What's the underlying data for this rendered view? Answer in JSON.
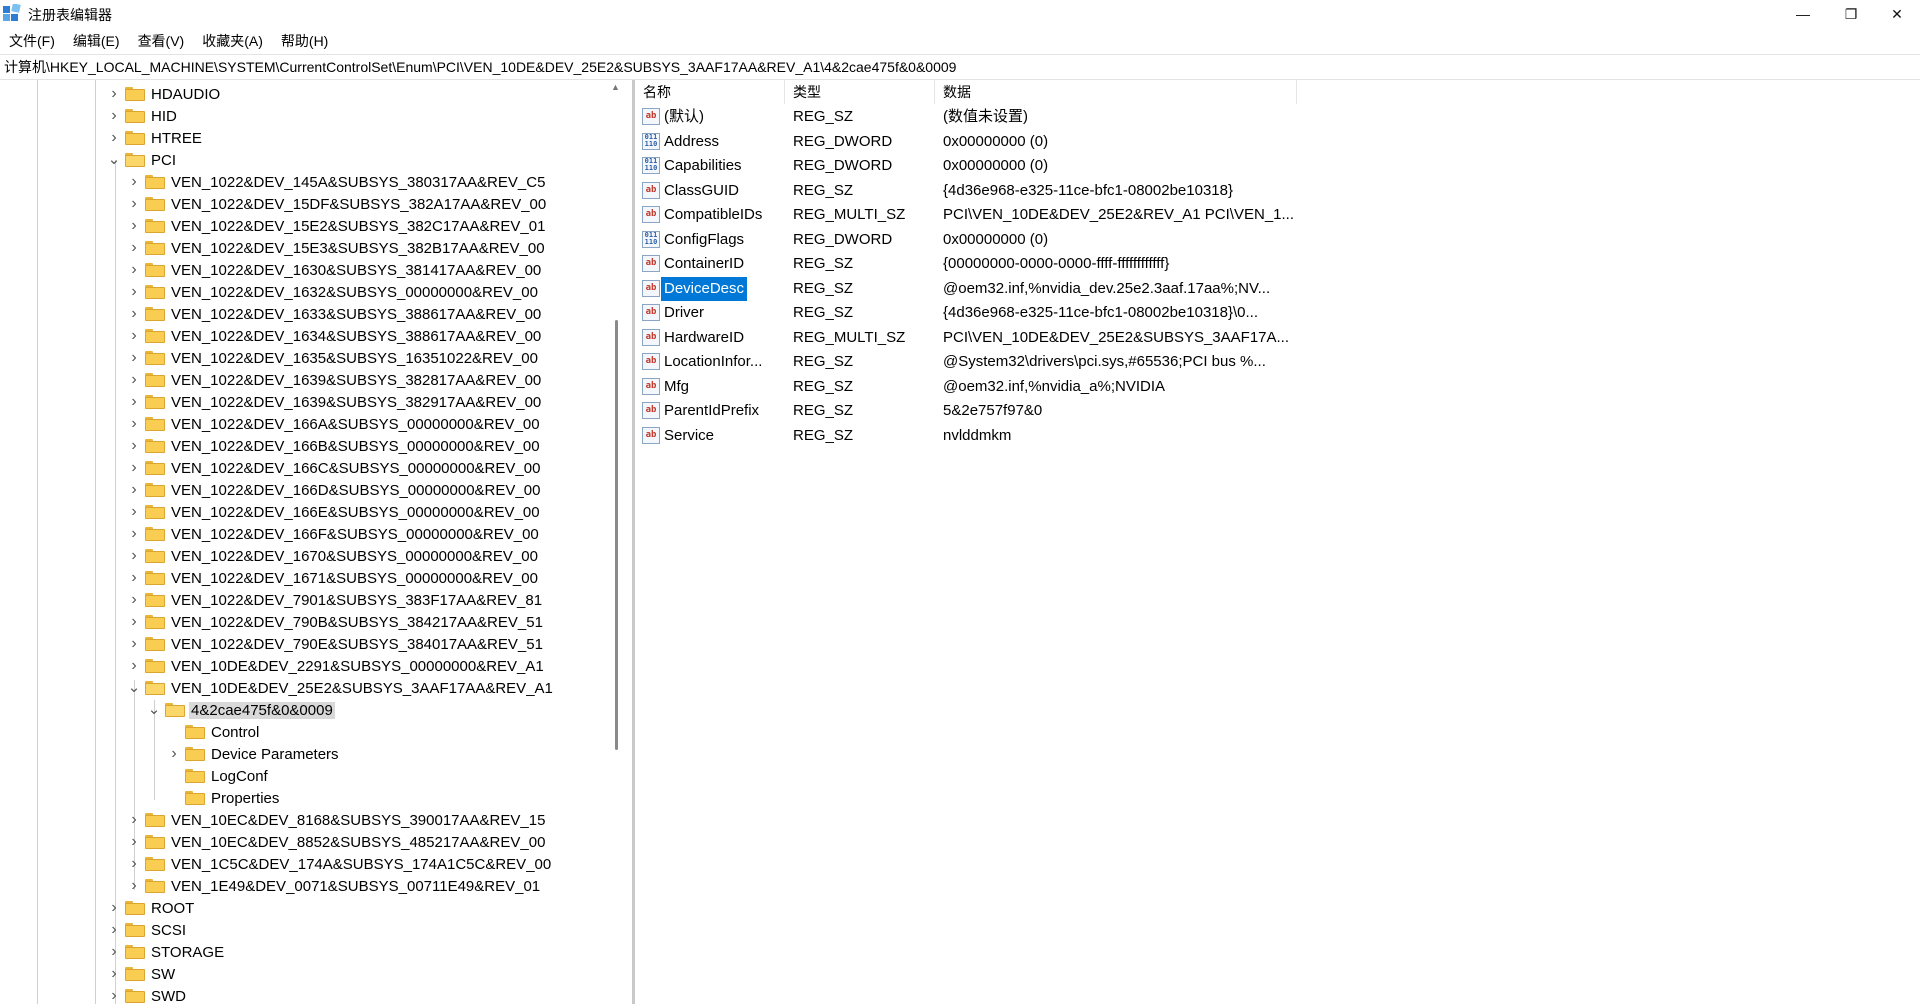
{
  "window": {
    "title": "注册表编辑器",
    "controls": {
      "minimize": "—",
      "maximize": "❐",
      "close": "✕"
    }
  },
  "menu": [
    "文件(F)",
    "编辑(E)",
    "查看(V)",
    "收藏夹(A)",
    "帮助(H)"
  ],
  "address": "计算机\\HKEY_LOCAL_MACHINE\\SYSTEM\\CurrentControlSet\\Enum\\PCI\\VEN_10DE&DEV_25E2&SUBSYS_3AAF17AA&REV_A1\\4&2cae475f&0&0009",
  "tree": [
    {
      "label": "HDAUDIO",
      "level": 0,
      "chev": "right"
    },
    {
      "label": "HID",
      "level": 0,
      "chev": "right"
    },
    {
      "label": "HTREE",
      "level": 0,
      "chev": "right"
    },
    {
      "label": "PCI",
      "level": 0,
      "chev": "down"
    },
    {
      "label": "VEN_1022&DEV_145A&SUBSYS_380317AA&REV_C5",
      "level": 1,
      "chev": "right"
    },
    {
      "label": "VEN_1022&DEV_15DF&SUBSYS_382A17AA&REV_00",
      "level": 1,
      "chev": "right"
    },
    {
      "label": "VEN_1022&DEV_15E2&SUBSYS_382C17AA&REV_01",
      "level": 1,
      "chev": "right"
    },
    {
      "label": "VEN_1022&DEV_15E3&SUBSYS_382B17AA&REV_00",
      "level": 1,
      "chev": "right"
    },
    {
      "label": "VEN_1022&DEV_1630&SUBSYS_381417AA&REV_00",
      "level": 1,
      "chev": "right"
    },
    {
      "label": "VEN_1022&DEV_1632&SUBSYS_00000000&REV_00",
      "level": 1,
      "chev": "right"
    },
    {
      "label": "VEN_1022&DEV_1633&SUBSYS_388617AA&REV_00",
      "level": 1,
      "chev": "right"
    },
    {
      "label": "VEN_1022&DEV_1634&SUBSYS_388617AA&REV_00",
      "level": 1,
      "chev": "right"
    },
    {
      "label": "VEN_1022&DEV_1635&SUBSYS_16351022&REV_00",
      "level": 1,
      "chev": "right"
    },
    {
      "label": "VEN_1022&DEV_1639&SUBSYS_382817AA&REV_00",
      "level": 1,
      "chev": "right"
    },
    {
      "label": "VEN_1022&DEV_1639&SUBSYS_382917AA&REV_00",
      "level": 1,
      "chev": "right"
    },
    {
      "label": "VEN_1022&DEV_166A&SUBSYS_00000000&REV_00",
      "level": 1,
      "chev": "right"
    },
    {
      "label": "VEN_1022&DEV_166B&SUBSYS_00000000&REV_00",
      "level": 1,
      "chev": "right"
    },
    {
      "label": "VEN_1022&DEV_166C&SUBSYS_00000000&REV_00",
      "level": 1,
      "chev": "right"
    },
    {
      "label": "VEN_1022&DEV_166D&SUBSYS_00000000&REV_00",
      "level": 1,
      "chev": "right"
    },
    {
      "label": "VEN_1022&DEV_166E&SUBSYS_00000000&REV_00",
      "level": 1,
      "chev": "right"
    },
    {
      "label": "VEN_1022&DEV_166F&SUBSYS_00000000&REV_00",
      "level": 1,
      "chev": "right"
    },
    {
      "label": "VEN_1022&DEV_1670&SUBSYS_00000000&REV_00",
      "level": 1,
      "chev": "right"
    },
    {
      "label": "VEN_1022&DEV_1671&SUBSYS_00000000&REV_00",
      "level": 1,
      "chev": "right"
    },
    {
      "label": "VEN_1022&DEV_7901&SUBSYS_383F17AA&REV_81",
      "level": 1,
      "chev": "right"
    },
    {
      "label": "VEN_1022&DEV_790B&SUBSYS_384217AA&REV_51",
      "level": 1,
      "chev": "right"
    },
    {
      "label": "VEN_1022&DEV_790E&SUBSYS_384017AA&REV_51",
      "level": 1,
      "chev": "right"
    },
    {
      "label": "VEN_10DE&DEV_2291&SUBSYS_00000000&REV_A1",
      "level": 1,
      "chev": "right"
    },
    {
      "label": "VEN_10DE&DEV_25E2&SUBSYS_3AAF17AA&REV_A1",
      "level": 1,
      "chev": "down"
    },
    {
      "label": "4&2cae475f&0&0009",
      "level": 2,
      "chev": "down",
      "selected": true
    },
    {
      "label": "Control",
      "level": 3,
      "chev": "none"
    },
    {
      "label": "Device Parameters",
      "level": 3,
      "chev": "right"
    },
    {
      "label": "LogConf",
      "level": 3,
      "chev": "none"
    },
    {
      "label": "Properties",
      "level": 3,
      "chev": "none"
    },
    {
      "label": "VEN_10EC&DEV_8168&SUBSYS_390017AA&REV_15",
      "level": 1,
      "chev": "right"
    },
    {
      "label": "VEN_10EC&DEV_8852&SUBSYS_485217AA&REV_00",
      "level": 1,
      "chev": "right"
    },
    {
      "label": "VEN_1C5C&DEV_174A&SUBSYS_174A1C5C&REV_00",
      "level": 1,
      "chev": "right"
    },
    {
      "label": "VEN_1E49&DEV_0071&SUBSYS_00711E49&REV_01",
      "level": 1,
      "chev": "right"
    },
    {
      "label": "ROOT",
      "level": 0,
      "chev": "right"
    },
    {
      "label": "SCSI",
      "level": 0,
      "chev": "right"
    },
    {
      "label": "STORAGE",
      "level": 0,
      "chev": "right"
    },
    {
      "label": "SW",
      "level": 0,
      "chev": "right"
    },
    {
      "label": "SWD",
      "level": 0,
      "chev": "right"
    }
  ],
  "columns": {
    "name": "名称",
    "type": "类型",
    "data": "数据"
  },
  "values": [
    {
      "icon": "sz",
      "name": "(默认)",
      "type": "REG_SZ",
      "data": "(数值未设置)"
    },
    {
      "icon": "bin",
      "name": "Address",
      "type": "REG_DWORD",
      "data": "0x00000000 (0)"
    },
    {
      "icon": "bin",
      "name": "Capabilities",
      "type": "REG_DWORD",
      "data": "0x00000000 (0)"
    },
    {
      "icon": "sz",
      "name": "ClassGUID",
      "type": "REG_SZ",
      "data": "{4d36e968-e325-11ce-bfc1-08002be10318}"
    },
    {
      "icon": "sz",
      "name": "CompatibleIDs",
      "type": "REG_MULTI_SZ",
      "data": "PCI\\VEN_10DE&DEV_25E2&REV_A1 PCI\\VEN_1..."
    },
    {
      "icon": "bin",
      "name": "ConfigFlags",
      "type": "REG_DWORD",
      "data": "0x00000000 (0)"
    },
    {
      "icon": "sz",
      "name": "ContainerID",
      "type": "REG_SZ",
      "data": "{00000000-0000-0000-ffff-ffffffffffff}"
    },
    {
      "icon": "sz",
      "name": "DeviceDesc",
      "type": "REG_SZ",
      "data": "@oem32.inf,%nvidia_dev.25e2.3aaf.17aa%;NV...",
      "selected": true
    },
    {
      "icon": "sz",
      "name": "Driver",
      "type": "REG_SZ",
      "data": "{4d36e968-e325-11ce-bfc1-08002be10318}\\0..."
    },
    {
      "icon": "sz",
      "name": "HardwareID",
      "type": "REG_MULTI_SZ",
      "data": "PCI\\VEN_10DE&DEV_25E2&SUBSYS_3AAF17A..."
    },
    {
      "icon": "sz",
      "name": "LocationInfor...",
      "type": "REG_SZ",
      "data": "@System32\\drivers\\pci.sys,#65536;PCI bus %..."
    },
    {
      "icon": "sz",
      "name": "Mfg",
      "type": "REG_SZ",
      "data": "@oem32.inf,%nvidia_a%;NVIDIA"
    },
    {
      "icon": "sz",
      "name": "ParentIdPrefix",
      "type": "REG_SZ",
      "data": "5&2e757f97&0"
    },
    {
      "icon": "sz",
      "name": "Service",
      "type": "REG_SZ",
      "data": "nvlddmkm"
    }
  ],
  "colors": {
    "selection": "#0078d7",
    "tree_selection": "#d9d9d9",
    "folder": "#f8cd52"
  }
}
